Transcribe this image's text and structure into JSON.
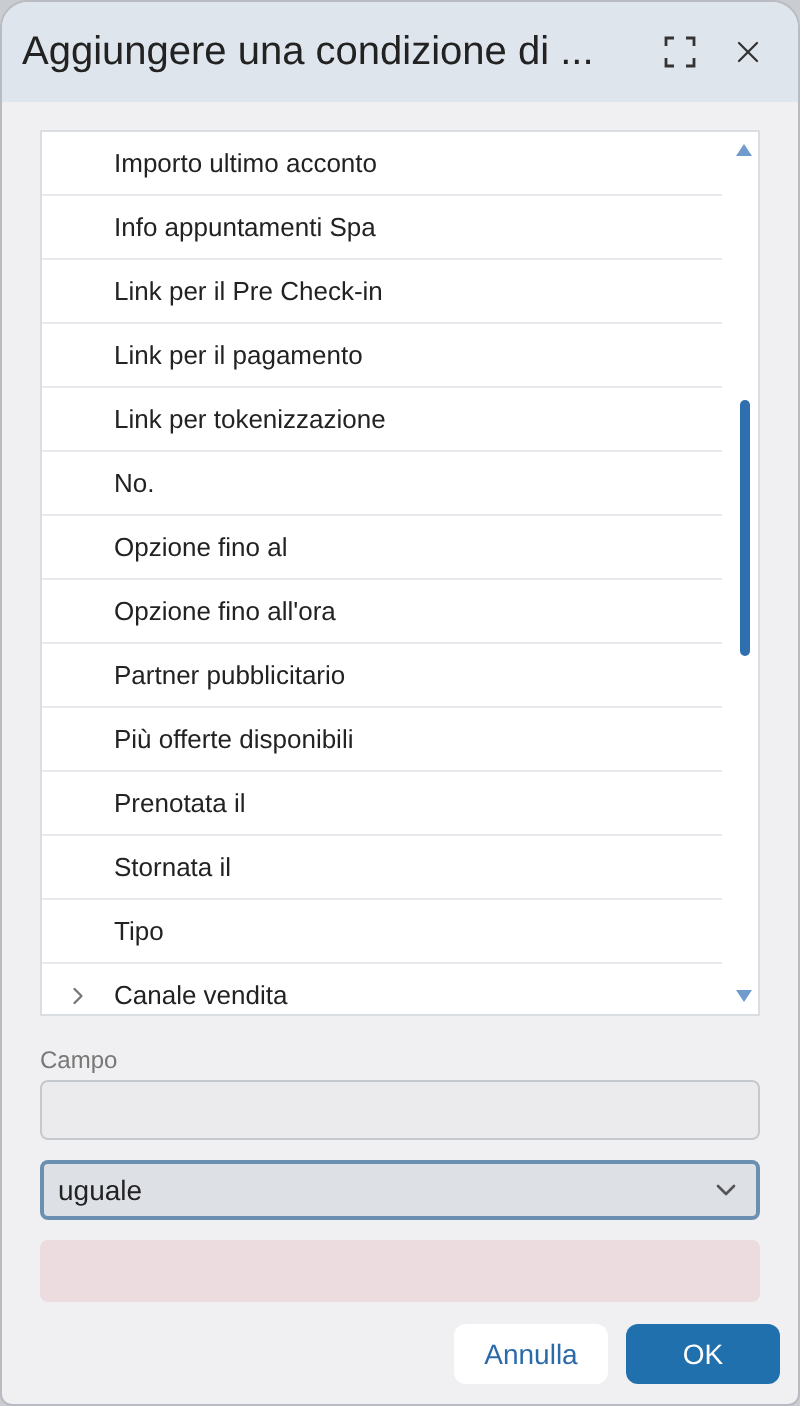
{
  "dialog": {
    "title": "Aggiungere una condizione di ..."
  },
  "fields_list": {
    "items": [
      {
        "label": "Importo ultimo acconto",
        "kind": "leaf"
      },
      {
        "label": "Info appuntamenti Spa",
        "kind": "leaf"
      },
      {
        "label": "Link per il Pre Check-in",
        "kind": "leaf"
      },
      {
        "label": "Link per il pagamento",
        "kind": "leaf"
      },
      {
        "label": "Link per tokenizzazione",
        "kind": "leaf"
      },
      {
        "label": "No.",
        "kind": "leaf"
      },
      {
        "label": "Opzione fino al",
        "kind": "leaf"
      },
      {
        "label": "Opzione fino all'ora",
        "kind": "leaf"
      },
      {
        "label": "Partner pubblicitario",
        "kind": "leaf"
      },
      {
        "label": "Più offerte disponibili",
        "kind": "leaf"
      },
      {
        "label": "Prenotata il",
        "kind": "leaf"
      },
      {
        "label": "Stornata il",
        "kind": "leaf"
      },
      {
        "label": "Tipo",
        "kind": "leaf"
      },
      {
        "label": "Canale vendita",
        "kind": "group",
        "expanded": false
      }
    ]
  },
  "field": {
    "label": "Campo"
  },
  "operator": {
    "value": "uguale"
  },
  "buttons": {
    "cancel": "Annulla",
    "ok": "OK"
  }
}
